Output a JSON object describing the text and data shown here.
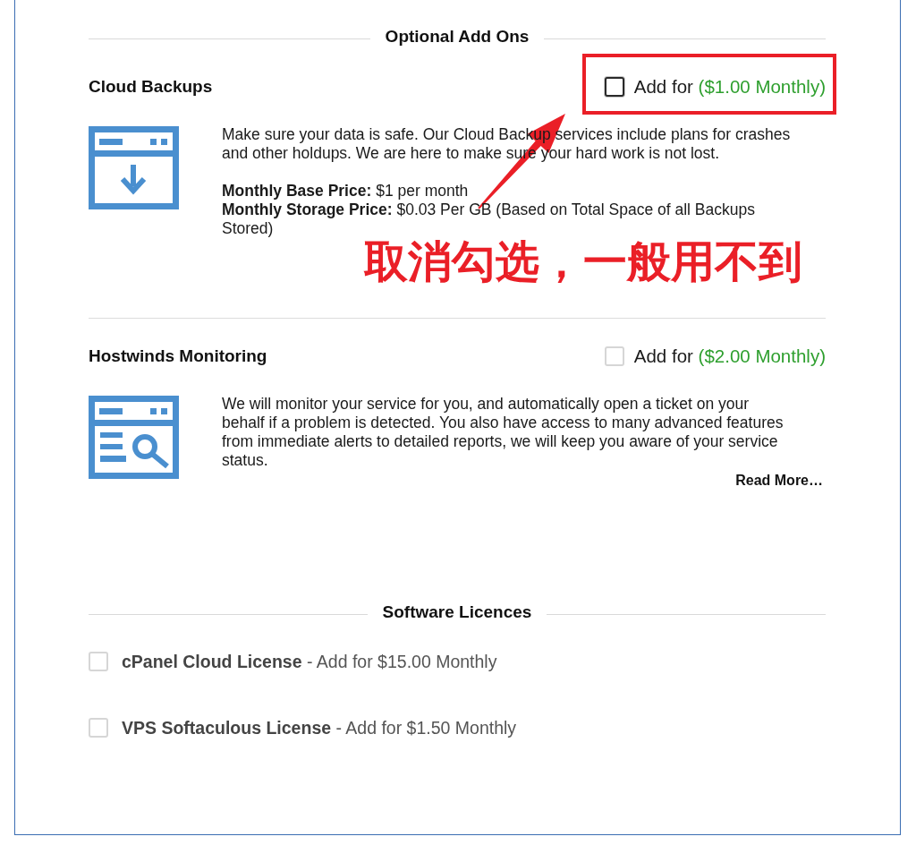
{
  "sections": [
    {
      "kind": "addons",
      "title": "Optional Add Ons",
      "addons": [
        {
          "kind": "backup",
          "name": "Cloud Backups",
          "checked": false,
          "focused": true,
          "highlighted": true,
          "add_label": "Add for",
          "price": "($1.00 Monthly)",
          "description": "Make sure your data is safe. Our Cloud Backup services include plans for crashes and other holdups. We are here to make sure your hard work is not lost.",
          "details": [
            "**Monthly Base Price:** $1 per month",
            "**Monthly Storage Price:** $0.03 Per GB (Based on Total Space of all Backups Stored)"
          ]
        },
        {
          "kind": "monitoring",
          "name": "Hostwinds Monitoring",
          "checked": false,
          "focused": false,
          "highlighted": false,
          "add_label": "Add for",
          "price": "($2.00 Monthly)",
          "description": "We will monitor your service for you, and automatically open a ticket on your behalf if a problem is detected. You also have access to many advanced features from immediate alerts to detailed reports, we will keep you aware of your service status.",
          "read_more": "Read More…"
        }
      ]
    },
    {
      "kind": "licences",
      "title": "Software Licences",
      "items": [
        {
          "label": "**cPanel Cloud License** - Add for $15.00 Monthly",
          "checked": false
        },
        {
          "label": "**VPS Softaculous License** - Add for $1.50 Monthly",
          "checked": false
        }
      ]
    }
  ],
  "annotation": {
    "text": "取消勾选，一般用不到"
  }
}
